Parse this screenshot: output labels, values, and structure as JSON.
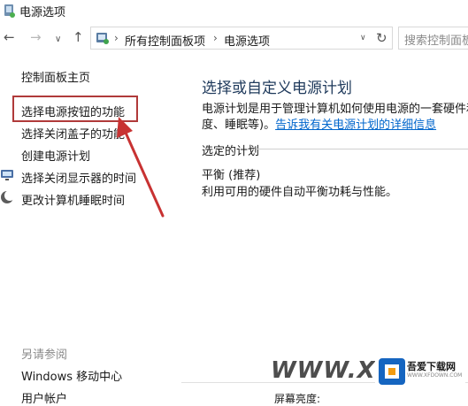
{
  "window": {
    "title": "电源选项"
  },
  "address_bar": {
    "back_icon": "arrow-left-icon",
    "forward_icon": "arrow-right-icon",
    "up_icon": "arrow-up-icon",
    "crumb_1": "所有控制面板项",
    "crumb_2": "电源选项",
    "refresh_icon": "refresh-icon",
    "search_placeholder": "搜索控制面板"
  },
  "sidebar": {
    "home": "控制面板主页",
    "items": [
      {
        "label": "选择电源按钮的功能"
      },
      {
        "label": "选择关闭盖子的功能"
      },
      {
        "label": "创建电源计划"
      },
      {
        "label": "选择关闭显示器的时间"
      },
      {
        "label": "更改计算机睡眠时间"
      }
    ],
    "see_also": "另请参阅",
    "see_also_items": [
      {
        "label": "Windows 移动中心"
      },
      {
        "label": "用户帐户"
      }
    ]
  },
  "main": {
    "title": "选择或自定义电源计划",
    "desc_line1": "电源计划是用于管理计算机如何使用电源的一套硬件和",
    "desc_line2_prefix": "度、睡眠等)。",
    "desc_link": "告诉我有关电源计划的详细信息",
    "section_label": "选定的计划",
    "plan_name": "平衡 (推荐)",
    "plan_desc": "利用可用的硬件自动平衡功耗与性能。",
    "brightness_label": "屏幕亮度:"
  },
  "watermark": {
    "text": "WWW.XFDC",
    "logo_text": "吾爱下载网",
    "logo_sub": "WWW.XFDOWN.COM"
  },
  "colors": {
    "accent_title": "#1e395b",
    "link": "#0066cc",
    "highlight": "#b03a3a"
  }
}
